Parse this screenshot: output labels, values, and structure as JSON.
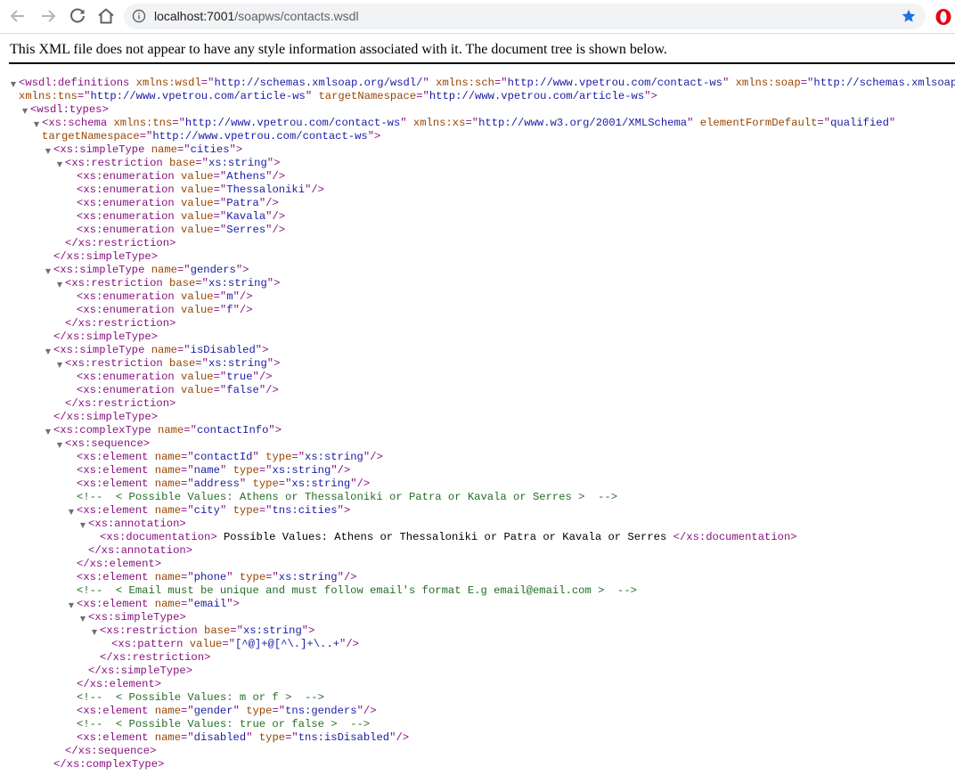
{
  "browser": {
    "url_host": "localhost:7001",
    "url_path": "/soapws/contacts.wsdl",
    "star_color": "#1a73e8",
    "opera_color": "#e30613"
  },
  "viewer": {
    "banner": "This XML file does not appear to have any style information associated with it. The document tree is shown below."
  },
  "xml_lines": [
    {
      "indent": 0,
      "toggle": true,
      "tokens": [
        [
          "t",
          "<wsdl:definitions "
        ],
        [
          "n",
          "xmlns:wsdl"
        ],
        [
          "t",
          "=\""
        ],
        [
          "v",
          "http://schemas.xmlsoap.org/wsdl/"
        ],
        [
          "t",
          "\" "
        ],
        [
          "n",
          "xmlns:sch"
        ],
        [
          "t",
          "=\""
        ],
        [
          "v",
          "http://www.vpetrou.com/contact-ws"
        ],
        [
          "t",
          "\" "
        ],
        [
          "n",
          "xmlns:soap"
        ],
        [
          "t",
          "=\""
        ],
        [
          "v",
          "http://schemas.xmlsoap.org/"
        ]
      ]
    },
    {
      "indent": 0,
      "cont": true,
      "tokens": [
        [
          "n",
          "xmlns:tns"
        ],
        [
          "t",
          "=\""
        ],
        [
          "v",
          "http://www.vpetrou.com/article-ws"
        ],
        [
          "t",
          "\" "
        ],
        [
          "n",
          "targetNamespace"
        ],
        [
          "t",
          "=\""
        ],
        [
          "v",
          "http://www.vpetrou.com/article-ws"
        ],
        [
          "t",
          "\">"
        ]
      ]
    },
    {
      "indent": 1,
      "toggle": true,
      "tokens": [
        [
          "t",
          "<wsdl:types>"
        ]
      ]
    },
    {
      "indent": 2,
      "toggle": true,
      "tokens": [
        [
          "t",
          "<xs:schema "
        ],
        [
          "n",
          "xmlns:tns"
        ],
        [
          "t",
          "=\""
        ],
        [
          "v",
          "http://www.vpetrou.com/contact-ws"
        ],
        [
          "t",
          "\" "
        ],
        [
          "n",
          "xmlns:xs"
        ],
        [
          "t",
          "=\""
        ],
        [
          "v",
          "http://www.w3.org/2001/XMLSchema"
        ],
        [
          "t",
          "\" "
        ],
        [
          "n",
          "elementFormDefault"
        ],
        [
          "t",
          "=\""
        ],
        [
          "v",
          "qualified"
        ],
        [
          "t",
          "\""
        ]
      ]
    },
    {
      "indent": 2,
      "cont": true,
      "tokens": [
        [
          "n",
          "targetNamespace"
        ],
        [
          "t",
          "=\""
        ],
        [
          "v",
          "http://www.vpetrou.com/contact-ws"
        ],
        [
          "t",
          "\">"
        ]
      ]
    },
    {
      "indent": 3,
      "toggle": true,
      "tokens": [
        [
          "t",
          "<xs:simpleType "
        ],
        [
          "n",
          "name"
        ],
        [
          "t",
          "=\""
        ],
        [
          "v",
          "cities"
        ],
        [
          "t",
          "\">"
        ]
      ]
    },
    {
      "indent": 4,
      "toggle": true,
      "tokens": [
        [
          "t",
          "<xs:restriction "
        ],
        [
          "n",
          "base"
        ],
        [
          "t",
          "=\""
        ],
        [
          "v",
          "xs:string"
        ],
        [
          "t",
          "\">"
        ]
      ]
    },
    {
      "indent": 5,
      "tokens": [
        [
          "t",
          "<xs:enumeration "
        ],
        [
          "n",
          "value"
        ],
        [
          "t",
          "=\""
        ],
        [
          "v",
          "Athens"
        ],
        [
          "t",
          "\"/>"
        ]
      ]
    },
    {
      "indent": 5,
      "tokens": [
        [
          "t",
          "<xs:enumeration "
        ],
        [
          "n",
          "value"
        ],
        [
          "t",
          "=\""
        ],
        [
          "v",
          "Thessaloniki"
        ],
        [
          "t",
          "\"/>"
        ]
      ]
    },
    {
      "indent": 5,
      "tokens": [
        [
          "t",
          "<xs:enumeration "
        ],
        [
          "n",
          "value"
        ],
        [
          "t",
          "=\""
        ],
        [
          "v",
          "Patra"
        ],
        [
          "t",
          "\"/>"
        ]
      ]
    },
    {
      "indent": 5,
      "tokens": [
        [
          "t",
          "<xs:enumeration "
        ],
        [
          "n",
          "value"
        ],
        [
          "t",
          "=\""
        ],
        [
          "v",
          "Kavala"
        ],
        [
          "t",
          "\"/>"
        ]
      ]
    },
    {
      "indent": 5,
      "tokens": [
        [
          "t",
          "<xs:enumeration "
        ],
        [
          "n",
          "value"
        ],
        [
          "t",
          "=\""
        ],
        [
          "v",
          "Serres"
        ],
        [
          "t",
          "\"/>"
        ]
      ]
    },
    {
      "indent": 4,
      "tokens": [
        [
          "t",
          "</xs:restriction>"
        ]
      ]
    },
    {
      "indent": 3,
      "tokens": [
        [
          "t",
          "</xs:simpleType>"
        ]
      ]
    },
    {
      "indent": 3,
      "toggle": true,
      "tokens": [
        [
          "t",
          "<xs:simpleType "
        ],
        [
          "n",
          "name"
        ],
        [
          "t",
          "=\""
        ],
        [
          "v",
          "genders"
        ],
        [
          "t",
          "\">"
        ]
      ]
    },
    {
      "indent": 4,
      "toggle": true,
      "tokens": [
        [
          "t",
          "<xs:restriction "
        ],
        [
          "n",
          "base"
        ],
        [
          "t",
          "=\""
        ],
        [
          "v",
          "xs:string"
        ],
        [
          "t",
          "\">"
        ]
      ]
    },
    {
      "indent": 5,
      "tokens": [
        [
          "t",
          "<xs:enumeration "
        ],
        [
          "n",
          "value"
        ],
        [
          "t",
          "=\""
        ],
        [
          "v",
          "m"
        ],
        [
          "t",
          "\"/>"
        ]
      ]
    },
    {
      "indent": 5,
      "tokens": [
        [
          "t",
          "<xs:enumeration "
        ],
        [
          "n",
          "value"
        ],
        [
          "t",
          "=\""
        ],
        [
          "v",
          "f"
        ],
        [
          "t",
          "\"/>"
        ]
      ]
    },
    {
      "indent": 4,
      "tokens": [
        [
          "t",
          "</xs:restriction>"
        ]
      ]
    },
    {
      "indent": 3,
      "tokens": [
        [
          "t",
          "</xs:simpleType>"
        ]
      ]
    },
    {
      "indent": 3,
      "toggle": true,
      "tokens": [
        [
          "t",
          "<xs:simpleType "
        ],
        [
          "n",
          "name"
        ],
        [
          "t",
          "=\""
        ],
        [
          "v",
          "isDisabled"
        ],
        [
          "t",
          "\">"
        ]
      ]
    },
    {
      "indent": 4,
      "toggle": true,
      "tokens": [
        [
          "t",
          "<xs:restriction "
        ],
        [
          "n",
          "base"
        ],
        [
          "t",
          "=\""
        ],
        [
          "v",
          "xs:string"
        ],
        [
          "t",
          "\">"
        ]
      ]
    },
    {
      "indent": 5,
      "tokens": [
        [
          "t",
          "<xs:enumeration "
        ],
        [
          "n",
          "value"
        ],
        [
          "t",
          "=\""
        ],
        [
          "v",
          "true"
        ],
        [
          "t",
          "\"/>"
        ]
      ]
    },
    {
      "indent": 5,
      "tokens": [
        [
          "t",
          "<xs:enumeration "
        ],
        [
          "n",
          "value"
        ],
        [
          "t",
          "=\""
        ],
        [
          "v",
          "false"
        ],
        [
          "t",
          "\"/>"
        ]
      ]
    },
    {
      "indent": 4,
      "tokens": [
        [
          "t",
          "</xs:restriction>"
        ]
      ]
    },
    {
      "indent": 3,
      "tokens": [
        [
          "t",
          "</xs:simpleType>"
        ]
      ]
    },
    {
      "indent": 3,
      "toggle": true,
      "tokens": [
        [
          "t",
          "<xs:complexType "
        ],
        [
          "n",
          "name"
        ],
        [
          "t",
          "=\""
        ],
        [
          "v",
          "contactInfo"
        ],
        [
          "t",
          "\">"
        ]
      ]
    },
    {
      "indent": 4,
      "toggle": true,
      "tokens": [
        [
          "t",
          "<xs:sequence>"
        ]
      ]
    },
    {
      "indent": 5,
      "tokens": [
        [
          "t",
          "<xs:element "
        ],
        [
          "n",
          "name"
        ],
        [
          "t",
          "=\""
        ],
        [
          "v",
          "contactId"
        ],
        [
          "t",
          "\" "
        ],
        [
          "n",
          "type"
        ],
        [
          "t",
          "=\""
        ],
        [
          "v",
          "xs:string"
        ],
        [
          "t",
          "\"/>"
        ]
      ]
    },
    {
      "indent": 5,
      "tokens": [
        [
          "t",
          "<xs:element "
        ],
        [
          "n",
          "name"
        ],
        [
          "t",
          "=\""
        ],
        [
          "v",
          "name"
        ],
        [
          "t",
          "\" "
        ],
        [
          "n",
          "type"
        ],
        [
          "t",
          "=\""
        ],
        [
          "v",
          "xs:string"
        ],
        [
          "t",
          "\"/>"
        ]
      ]
    },
    {
      "indent": 5,
      "tokens": [
        [
          "t",
          "<xs:element "
        ],
        [
          "n",
          "name"
        ],
        [
          "t",
          "=\""
        ],
        [
          "v",
          "address"
        ],
        [
          "t",
          "\" "
        ],
        [
          "n",
          "type"
        ],
        [
          "t",
          "=\""
        ],
        [
          "v",
          "xs:string"
        ],
        [
          "t",
          "\"/>"
        ]
      ]
    },
    {
      "indent": 5,
      "tokens": [
        [
          "c",
          "<!--  < Possible Values: Athens or Thessaloniki or Patra or Kavala or Serres >  -->"
        ]
      ]
    },
    {
      "indent": 5,
      "toggle": true,
      "tokens": [
        [
          "t",
          "<xs:element "
        ],
        [
          "n",
          "name"
        ],
        [
          "t",
          "=\""
        ],
        [
          "v",
          "city"
        ],
        [
          "t",
          "\" "
        ],
        [
          "n",
          "type"
        ],
        [
          "t",
          "=\""
        ],
        [
          "v",
          "tns:cities"
        ],
        [
          "t",
          "\">"
        ]
      ]
    },
    {
      "indent": 6,
      "toggle": true,
      "tokens": [
        [
          "t",
          "<xs:annotation>"
        ]
      ]
    },
    {
      "indent": 7,
      "tokens": [
        [
          "t",
          "<xs:documentation>"
        ],
        [
          "x",
          " Possible Values: Athens or Thessaloniki or Patra or Kavala or Serres "
        ],
        [
          "t",
          "</xs:documentation>"
        ]
      ]
    },
    {
      "indent": 6,
      "tokens": [
        [
          "t",
          "</xs:annotation>"
        ]
      ]
    },
    {
      "indent": 5,
      "tokens": [
        [
          "t",
          "</xs:element>"
        ]
      ]
    },
    {
      "indent": 5,
      "tokens": [
        [
          "t",
          "<xs:element "
        ],
        [
          "n",
          "name"
        ],
        [
          "t",
          "=\""
        ],
        [
          "v",
          "phone"
        ],
        [
          "t",
          "\" "
        ],
        [
          "n",
          "type"
        ],
        [
          "t",
          "=\""
        ],
        [
          "v",
          "xs:string"
        ],
        [
          "t",
          "\"/>"
        ]
      ]
    },
    {
      "indent": 5,
      "tokens": [
        [
          "c",
          "<!--  < Email must be unique and must follow email's format E.g email@email.com >  -->"
        ]
      ]
    },
    {
      "indent": 5,
      "toggle": true,
      "tokens": [
        [
          "t",
          "<xs:element "
        ],
        [
          "n",
          "name"
        ],
        [
          "t",
          "=\""
        ],
        [
          "v",
          "email"
        ],
        [
          "t",
          "\">"
        ]
      ]
    },
    {
      "indent": 6,
      "toggle": true,
      "tokens": [
        [
          "t",
          "<xs:simpleType>"
        ]
      ]
    },
    {
      "indent": 7,
      "toggle": true,
      "tokens": [
        [
          "t",
          "<xs:restriction "
        ],
        [
          "n",
          "base"
        ],
        [
          "t",
          "=\""
        ],
        [
          "v",
          "xs:string"
        ],
        [
          "t",
          "\">"
        ]
      ]
    },
    {
      "indent": 8,
      "tokens": [
        [
          "t",
          "<xs:pattern "
        ],
        [
          "n",
          "value"
        ],
        [
          "t",
          "=\""
        ],
        [
          "v",
          "[^@]+@[^\\.]+\\..+"
        ],
        [
          "t",
          "\"/>"
        ]
      ]
    },
    {
      "indent": 7,
      "tokens": [
        [
          "t",
          "</xs:restriction>"
        ]
      ]
    },
    {
      "indent": 6,
      "tokens": [
        [
          "t",
          "</xs:simpleType>"
        ]
      ]
    },
    {
      "indent": 5,
      "tokens": [
        [
          "t",
          "</xs:element>"
        ]
      ]
    },
    {
      "indent": 5,
      "tokens": [
        [
          "c",
          "<!--  < Possible Values: m or f >  -->"
        ]
      ]
    },
    {
      "indent": 5,
      "tokens": [
        [
          "t",
          "<xs:element "
        ],
        [
          "n",
          "name"
        ],
        [
          "t",
          "=\""
        ],
        [
          "v",
          "gender"
        ],
        [
          "t",
          "\" "
        ],
        [
          "n",
          "type"
        ],
        [
          "t",
          "=\""
        ],
        [
          "v",
          "tns:genders"
        ],
        [
          "t",
          "\"/>"
        ]
      ]
    },
    {
      "indent": 5,
      "tokens": [
        [
          "c",
          "<!--  < Possible Values: true or false >  -->"
        ]
      ]
    },
    {
      "indent": 5,
      "tokens": [
        [
          "t",
          "<xs:element "
        ],
        [
          "n",
          "name"
        ],
        [
          "t",
          "=\""
        ],
        [
          "v",
          "disabled"
        ],
        [
          "t",
          "\" "
        ],
        [
          "n",
          "type"
        ],
        [
          "t",
          "=\""
        ],
        [
          "v",
          "tns:isDisabled"
        ],
        [
          "t",
          "\"/>"
        ]
      ]
    },
    {
      "indent": 4,
      "tokens": [
        [
          "t",
          "</xs:sequence>"
        ]
      ]
    },
    {
      "indent": 3,
      "tokens": [
        [
          "t",
          "</xs:complexType>"
        ]
      ]
    }
  ]
}
